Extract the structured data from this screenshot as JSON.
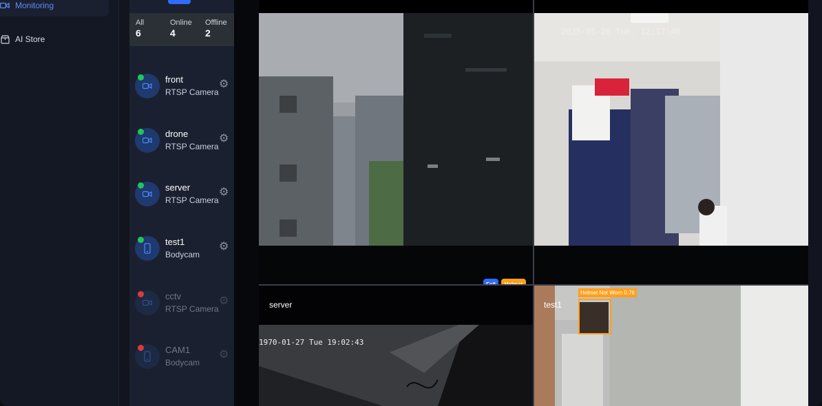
{
  "nav": {
    "items": [
      {
        "label": "Monitoring",
        "icon": "camera-icon",
        "active": true
      },
      {
        "label": "AI Store",
        "icon": "store-icon",
        "active": false
      }
    ]
  },
  "summary": {
    "all_label": "All",
    "all_value": "6",
    "online_label": "Online",
    "online_value": "4",
    "offline_label": "Offline",
    "offline_value": "2"
  },
  "devices": [
    {
      "name": "front",
      "type": "RTSP Camera",
      "status": "online",
      "icon": "video-camera-icon"
    },
    {
      "name": "drone",
      "type": "RTSP Camera",
      "status": "online",
      "icon": "video-camera-icon"
    },
    {
      "name": "server",
      "type": "RTSP Camera",
      "status": "online",
      "icon": "video-camera-icon"
    },
    {
      "name": "test1",
      "type": "Bodycam",
      "status": "online",
      "icon": "phone-icon"
    },
    {
      "name": "cctv",
      "type": "RTSP Camera",
      "status": "offline",
      "icon": "video-camera-icon"
    },
    {
      "name": "CAM1",
      "type": "Bodycam",
      "status": "offline",
      "icon": "phone-icon"
    }
  ],
  "feeds": {
    "front": {
      "badges": [
        "Fall",
        "Helmet"
      ]
    },
    "drone": {
      "timestamp": "2025-05-20 Tue. 12:17:46"
    },
    "server": {
      "label": "server",
      "timestamp": "1970-01-27 Tue 19:02:43"
    },
    "test1": {
      "label": "test1",
      "detection": "Helmet Not Worn 0.76"
    }
  },
  "colors": {
    "accent": "#2f6bff",
    "online": "#21c55d",
    "offline": "#d93a3a",
    "fall_badge": "#2f6bff",
    "helmet_badge": "#ff9f1a"
  }
}
